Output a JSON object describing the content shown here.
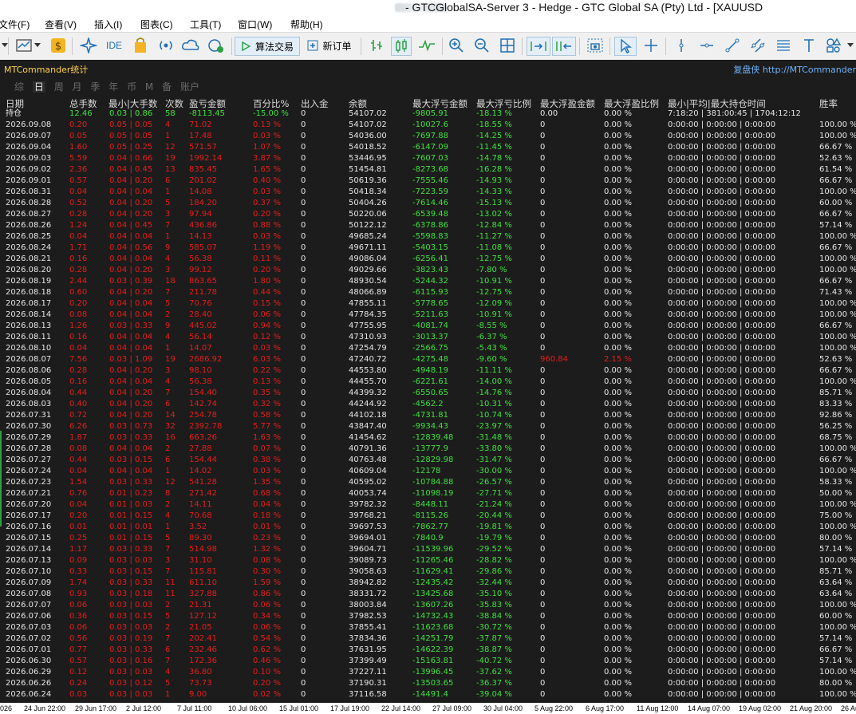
{
  "window": {
    "title": "- GTCGlobalSA-Server 3 - Hedge - GTC Global SA (Pty) Ltd - [XAUUSD"
  },
  "menu": [
    "文件(F)",
    "查看(V)",
    "插入(I)",
    "图表(C)",
    "工具(T)",
    "窗口(W)",
    "帮助(H)"
  ],
  "toolbar": {
    "ide_label": "IDE",
    "algo_label": "算法交易",
    "new_order_label": "新订单"
  },
  "panel": {
    "title": "MTCommander统计",
    "link": "复盘侠 http://MTCommander",
    "tabs": [
      "综",
      "日",
      "周",
      "月",
      "季",
      "年",
      "币",
      "M",
      "备",
      "账户"
    ],
    "active_tab": "日"
  },
  "columns": [
    "日期",
    "总手数",
    "最小|大手数",
    "次数",
    "盈亏金额",
    "百分比%",
    "出入金",
    "余额",
    "最大浮亏金额",
    "最大浮亏比例",
    "最大浮盈金额",
    "最大浮盈比例",
    "最小|平均|最大持仓时间",
    "胜率"
  ],
  "summary": {
    "label": "持仓",
    "lots": "12.46",
    "minmax": "0.03 | 0.86",
    "count": "58",
    "pnl": "-8113.45",
    "pct": "-15.00 %",
    "dep": "0",
    "bal": "54107.02",
    "mfl": "-9805.91",
    "mflp": "-18.13 %",
    "mfp": "0.00",
    "mfpp": "0.00 %",
    "hold": "7:18:20 | 381:00:45 | 1704:12:12",
    "win": ""
  },
  "rows": [
    [
      "2026.09.08",
      "0.20",
      "0.05 | 0.05",
      "4",
      "71.02",
      "0.13 %",
      "0",
      "54107.02",
      "-10027.6",
      "-18.55 %",
      "0",
      "0.00 %",
      "0:00:00 | 0:00:00 | 0:00:00",
      "100.00 %"
    ],
    [
      "2026.09.07",
      "0.05",
      "0.05 | 0.05",
      "1",
      "17.48",
      "0.03 %",
      "0",
      "54036.00",
      "-7697.88",
      "-14.25 %",
      "0",
      "0.00 %",
      "0:00:00 | 0:00:00 | 0:00:00",
      "100.00 %"
    ],
    [
      "2026.09.04",
      "1.60",
      "0.05 | 0.25",
      "12",
      "571.57",
      "1.07 %",
      "0",
      "54018.52",
      "-6147.09",
      "-11.45 %",
      "0",
      "0.00 %",
      "0:00:00 | 0:00:00 | 0:00:00",
      "66.67 %"
    ],
    [
      "2026.09.03",
      "5.59",
      "0.04 | 0.66",
      "19",
      "1992.14",
      "3.87 %",
      "0",
      "53446.95",
      "-7607.03",
      "-14.78 %",
      "0",
      "0.00 %",
      "0:00:00 | 0:00:00 | 0:00:00",
      "52.63 %"
    ],
    [
      "2026.09.02",
      "2.36",
      "0.04 | 0.45",
      "13",
      "835.45",
      "1.65 %",
      "0",
      "51454.81",
      "-8273.68",
      "-16.28 %",
      "0",
      "0.00 %",
      "0:00:00 | 0:00:00 | 0:00:00",
      "61.54 %"
    ],
    [
      "2026.09.01",
      "0.57",
      "0.04 | 0.20",
      "6",
      "201.02",
      "0.40 %",
      "0",
      "50619.36",
      "-7555.46",
      "-14.93 %",
      "0",
      "0.00 %",
      "0:00:00 | 0:00:00 | 0:00:00",
      "66.67 %"
    ],
    [
      "2026.08.31",
      "0.04",
      "0.04 | 0.04",
      "1",
      "14.08",
      "0.03 %",
      "0",
      "50418.34",
      "-7223.59",
      "-14.33 %",
      "0",
      "0.00 %",
      "0:00:00 | 0:00:00 | 0:00:00",
      "100.00 %"
    ],
    [
      "2026.08.28",
      "0.52",
      "0.04 | 0.20",
      "5",
      "184.20",
      "0.37 %",
      "0",
      "50404.26",
      "-7614.46",
      "-15.13 %",
      "0",
      "0.00 %",
      "0:00:00 | 0:00:00 | 0:00:00",
      "60.00 %"
    ],
    [
      "2026.08.27",
      "0.28",
      "0.04 | 0.20",
      "3",
      "97.94",
      "0.20 %",
      "0",
      "50220.06",
      "-6539.48",
      "-13.02 %",
      "0",
      "0.00 %",
      "0:00:00 | 0:00:00 | 0:00:00",
      "66.67 %"
    ],
    [
      "2026.08.26",
      "1.24",
      "0.04 | 0.45",
      "7",
      "436.86",
      "0.88 %",
      "0",
      "50122.12",
      "-6378.86",
      "-12.84 %",
      "0",
      "0.00 %",
      "0:00:00 | 0:00:00 | 0:00:00",
      "57.14 %"
    ],
    [
      "2026.08.25",
      "0.04",
      "0.04 | 0.04",
      "1",
      "14.13",
      "0.03 %",
      "0",
      "49685.24",
      "-5598.83",
      "-11.27 %",
      "0",
      "0.00 %",
      "0:00:00 | 0:00:00 | 0:00:00",
      "100.00 %"
    ],
    [
      "2026.08.24",
      "1.71",
      "0.04 | 0.56",
      "9",
      "585.07",
      "1.19 %",
      "0",
      "49671.11",
      "-5403.15",
      "-11.08 %",
      "0",
      "0.00 %",
      "0:00:00 | 0:00:00 | 0:00:00",
      "66.67 %"
    ],
    [
      "2026.08.21",
      "0.16",
      "0.04 | 0.04",
      "4",
      "56.38",
      "0.11 %",
      "0",
      "49086.04",
      "-6256.41",
      "-12.75 %",
      "0",
      "0.00 %",
      "0:00:00 | 0:00:00 | 0:00:00",
      "100.00 %"
    ],
    [
      "2026.08.20",
      "0.28",
      "0.04 | 0.20",
      "3",
      "99.12",
      "0.20 %",
      "0",
      "49029.66",
      "-3823.43",
      "-7.80 %",
      "0",
      "0.00 %",
      "0:00:00 | 0:00:00 | 0:00:00",
      "100.00 %"
    ],
    [
      "2026.08.19",
      "2.44",
      "0.03 | 0.39",
      "18",
      "863.65",
      "1.80 %",
      "0",
      "48930.54",
      "-5244.32",
      "-10.91 %",
      "0",
      "0.00 %",
      "0:00:00 | 0:00:00 | 0:00:00",
      "66.67 %"
    ],
    [
      "2026.08.18",
      "0.60",
      "0.04 | 0.20",
      "7",
      "211.78",
      "0.44 %",
      "0",
      "48066.89",
      "-6115.93",
      "-12.75 %",
      "0",
      "0.00 %",
      "0:00:00 | 0:00:00 | 0:00:00",
      "71.43 %"
    ],
    [
      "2026.08.17",
      "0.20",
      "0.04 | 0.04",
      "5",
      "70.76",
      "0.15 %",
      "0",
      "47855.11",
      "-5778.65",
      "-12.09 %",
      "0",
      "0.00 %",
      "0:00:00 | 0:00:00 | 0:00:00",
      "100.00 %"
    ],
    [
      "2026.08.14",
      "0.08",
      "0.04 | 0.04",
      "2",
      "28.40",
      "0.06 %",
      "0",
      "47784.35",
      "-5211.63",
      "-10.91 %",
      "0",
      "0.00 %",
      "0:00:00 | 0:00:00 | 0:00:00",
      "100.00 %"
    ],
    [
      "2026.08.13",
      "1.26",
      "0.03 | 0.33",
      "9",
      "445.02",
      "0.94 %",
      "0",
      "47755.95",
      "-4081.74",
      "-8.55 %",
      "0",
      "0.00 %",
      "0:00:00 | 0:00:00 | 0:00:00",
      "66.67 %"
    ],
    [
      "2026.08.11",
      "0.16",
      "0.04 | 0.04",
      "4",
      "56.14",
      "0.12 %",
      "0",
      "47310.93",
      "-3013.37",
      "-6.37 %",
      "0",
      "0.00 %",
      "0:00:00 | 0:00:00 | 0:00:00",
      "100.00 %"
    ],
    [
      "2026.08.10",
      "0.04",
      "0.04 | 0.04",
      "1",
      "14.07",
      "0.03 %",
      "0",
      "47254.79",
      "-2566.75",
      "-5.43 %",
      "0",
      "0.00 %",
      "0:00:00 | 0:00:00 | 0:00:00",
      "100.00 %"
    ],
    [
      "2026.08.07",
      "7.56",
      "0.03 | 1.09",
      "19",
      "2686.92",
      "6.03 %",
      "0",
      "47240.72",
      "-4275.48",
      "-9.60 %",
      "960.84",
      "2.15 %",
      "0:00:00 | 0:00:00 | 0:00:00",
      "52.63 %"
    ],
    [
      "2026.08.06",
      "0.28",
      "0.04 | 0.20",
      "3",
      "98.10",
      "0.22 %",
      "0",
      "44553.80",
      "-4948.19",
      "-11.11 %",
      "0",
      "0.00 %",
      "0:00:00 | 0:00:00 | 0:00:00",
      "66.67 %"
    ],
    [
      "2026.08.05",
      "0.16",
      "0.04 | 0.04",
      "4",
      "56.38",
      "0.13 %",
      "0",
      "44455.70",
      "-6221.61",
      "-14.00 %",
      "0",
      "0.00 %",
      "0:00:00 | 0:00:00 | 0:00:00",
      "100.00 %"
    ],
    [
      "2026.08.04",
      "0.44",
      "0.04 | 0.20",
      "7",
      "154.40",
      "0.35 %",
      "0",
      "44399.32",
      "-6550.65",
      "-14.76 %",
      "0",
      "0.00 %",
      "0:00:00 | 0:00:00 | 0:00:00",
      "85.71 %"
    ],
    [
      "2026.08.03",
      "0.40",
      "0.04 | 0.20",
      "6",
      "142.74",
      "0.32 %",
      "0",
      "44244.92",
      "-4562.2",
      "-10.31 %",
      "0",
      "0.00 %",
      "0:00:00 | 0:00:00 | 0:00:00",
      "83.33 %"
    ],
    [
      "2026.07.31",
      "0.72",
      "0.04 | 0.20",
      "14",
      "254.78",
      "0.58 %",
      "0",
      "44102.18",
      "-4731.81",
      "-10.74 %",
      "0",
      "0.00 %",
      "0:00:00 | 0:00:00 | 0:00:00",
      "92.86 %"
    ],
    [
      "2026.07.30",
      "6.26",
      "0.03 | 0.73",
      "32",
      "2392.78",
      "5.77 %",
      "0",
      "43847.40",
      "-9934.43",
      "-23.97 %",
      "0",
      "0.00 %",
      "0:00:00 | 0:00:00 | 0:00:00",
      "56.25 %"
    ],
    [
      "2026.07.29",
      "1.87",
      "0.03 | 0.33",
      "16",
      "663.26",
      "1.63 %",
      "0",
      "41454.62",
      "-12839.48",
      "-31.48 %",
      "0",
      "0.00 %",
      "0:00:00 | 0:00:00 | 0:00:00",
      "68.75 %"
    ],
    [
      "2026.07.28",
      "0.08",
      "0.04 | 0.04",
      "2",
      "27.88",
      "0.07 %",
      "0",
      "40791.36",
      "-13777.9",
      "-33.80 %",
      "0",
      "0.00 %",
      "0:00:00 | 0:00:00 | 0:00:00",
      "100.00 %"
    ],
    [
      "2026.07.27",
      "0.44",
      "0.03 | 0.15",
      "6",
      "154.44",
      "0.38 %",
      "0",
      "40763.48",
      "-12829.98",
      "-31.47 %",
      "0",
      "0.00 %",
      "0:00:00 | 0:00:00 | 0:00:00",
      "66.67 %"
    ],
    [
      "2026.07.24",
      "0.04",
      "0.04 | 0.04",
      "1",
      "14.02",
      "0.03 %",
      "0",
      "40609.04",
      "-12178",
      "-30.00 %",
      "0",
      "0.00 %",
      "0:00:00 | 0:00:00 | 0:00:00",
      "100.00 %"
    ],
    [
      "2026.07.23",
      "1.54",
      "0.03 | 0.33",
      "12",
      "541.28",
      "1.35 %",
      "0",
      "40595.02",
      "-10784.88",
      "-26.57 %",
      "0",
      "0.00 %",
      "0:00:00 | 0:00:00 | 0:00:00",
      "58.33 %"
    ],
    [
      "2026.07.21",
      "0.76",
      "0.01 | 0.23",
      "8",
      "271.42",
      "0.68 %",
      "0",
      "40053.74",
      "-11098.19",
      "-27.71 %",
      "0",
      "0.00 %",
      "0:00:00 | 0:00:00 | 0:00:00",
      "50.00 %"
    ],
    [
      "2026.07.20",
      "0.04",
      "0.01 | 0.03",
      "2",
      "14.11",
      "0.04 %",
      "0",
      "39782.32",
      "-8448.11",
      "-21.24 %",
      "0",
      "0.00 %",
      "0:00:00 | 0:00:00 | 0:00:00",
      "100.00 %"
    ],
    [
      "2026.07.17",
      "0.20",
      "0.01 | 0.15",
      "4",
      "70.68",
      "0.18 %",
      "0",
      "39768.21",
      "-8115.26",
      "-20.44 %",
      "0",
      "0.00 %",
      "0:00:00 | 0:00:00 | 0:00:00",
      "75.00 %"
    ],
    [
      "2026.07.16",
      "0.01",
      "0.01 | 0.01",
      "1",
      "3.52",
      "0.01 %",
      "0",
      "39697.53",
      "-7862.77",
      "-19.81 %",
      "0",
      "0.00 %",
      "0:00:00 | 0:00:00 | 0:00:00",
      "100.00 %"
    ],
    [
      "2026.07.15",
      "0.25",
      "0.01 | 0.15",
      "5",
      "89.30",
      "0.23 %",
      "0",
      "39694.01",
      "-7840.9",
      "-19.79 %",
      "0",
      "0.00 %",
      "0:00:00 | 0:00:00 | 0:00:00",
      "80.00 %"
    ],
    [
      "2026.07.14",
      "1.17",
      "0.03 | 0.33",
      "7",
      "514.98",
      "1.32 %",
      "0",
      "39604.71",
      "-11539.96",
      "-29.52 %",
      "0",
      "0.00 %",
      "0:00:00 | 0:00:00 | 0:00:00",
      "57.14 %"
    ],
    [
      "2026.07.13",
      "0.09",
      "0.03 | 0.03",
      "3",
      "31.10",
      "0.08 %",
      "0",
      "39089.73",
      "-11265.46",
      "-28.82 %",
      "0",
      "0.00 %",
      "0:00:00 | 0:00:00 | 0:00:00",
      "100.00 %"
    ],
    [
      "2026.07.10",
      "0.33",
      "0.03 | 0.15",
      "7",
      "115.81",
      "0.30 %",
      "0",
      "39058.63",
      "-11629.41",
      "-29.86 %",
      "0",
      "0.00 %",
      "0:00:00 | 0:00:00 | 0:00:00",
      "85.71 %"
    ],
    [
      "2026.07.09",
      "1.74",
      "0.03 | 0.33",
      "11",
      "611.10",
      "1.59 %",
      "0",
      "38942.82",
      "-12435.42",
      "-32.44 %",
      "0",
      "0.00 %",
      "0:00:00 | 0:00:00 | 0:00:00",
      "63.64 %"
    ],
    [
      "2026.07.08",
      "0.93",
      "0.03 | 0.18",
      "11",
      "327.88",
      "0.86 %",
      "0",
      "38331.72",
      "-13425.68",
      "-35.10 %",
      "0",
      "0.00 %",
      "0:00:00 | 0:00:00 | 0:00:00",
      "63.64 %"
    ],
    [
      "2026.07.07",
      "0.06",
      "0.03 | 0.03",
      "2",
      "21.31",
      "0.06 %",
      "0",
      "38003.84",
      "-13607.26",
      "-35.83 %",
      "0",
      "0.00 %",
      "0:00:00 | 0:00:00 | 0:00:00",
      "100.00 %"
    ],
    [
      "2026.07.06",
      "0.36",
      "0.03 | 0.15",
      "5",
      "127.12",
      "0.34 %",
      "0",
      "37982.53",
      "-14732.43",
      "-38.84 %",
      "0",
      "0.00 %",
      "0:00:00 | 0:00:00 | 0:00:00",
      "60.00 %"
    ],
    [
      "2026.07.03",
      "0.06",
      "0.03 | 0.03",
      "2",
      "21.05",
      "0.06 %",
      "0",
      "37855.41",
      "-11623.68",
      "-30.72 %",
      "0",
      "0.00 %",
      "0:00:00 | 0:00:00 | 0:00:00",
      "100.00 %"
    ],
    [
      "2026.07.02",
      "0.56",
      "0.03 | 0.19",
      "7",
      "202.41",
      "0.54 %",
      "0",
      "37834.36",
      "-14251.79",
      "-37.87 %",
      "0",
      "0.00 %",
      "0:00:00 | 0:00:00 | 0:00:00",
      "57.14 %"
    ],
    [
      "2026.07.01",
      "0.77",
      "0.03 | 0.33",
      "6",
      "232.46",
      "0.62 %",
      "0",
      "37631.95",
      "-14622.39",
      "-38.87 %",
      "0",
      "0.00 %",
      "0:00:00 | 0:00:00 | 0:00:00",
      "66.67 %"
    ],
    [
      "2026.06.30",
      "0.57",
      "0.03 | 0.16",
      "7",
      "172.36",
      "0.46 %",
      "0",
      "37399.49",
      "-15163.81",
      "-40.72 %",
      "0",
      "0.00 %",
      "0:00:00 | 0:00:00 | 0:00:00",
      "57.14 %"
    ],
    [
      "2026.06.29",
      "0.12",
      "0.03 | 0.03",
      "4",
      "36.80",
      "0.10 %",
      "0",
      "37227.11",
      "-13996.45",
      "-37.62 %",
      "0",
      "0.00 %",
      "0:00:00 | 0:00:00 | 0:00:00",
      "100.00 %"
    ],
    [
      "2026.06.26",
      "0.24",
      "0.03 | 0.12",
      "5",
      "73.73",
      "0.20 %",
      "0",
      "37190.31",
      "-13503.65",
      "-36.37 %",
      "0",
      "0.00 %",
      "0:00:00 | 0:00:00 | 0:00:00",
      "80.00 %"
    ],
    [
      "2026.06.24",
      "0.03",
      "0.03 | 0.03",
      "1",
      "9.00",
      "0.02 %",
      "0",
      "37116.58",
      "-14491.4",
      "-39.04 %",
      "0",
      "0.00 %",
      "0:00:00 | 0:00:00 | 0:00:00",
      "100.00 %"
    ]
  ],
  "axis_labels": [
    "026",
    "24 Jun 22:00",
    "29 Jun 17:00",
    "2 Jul 12:00",
    "7 Jul 11:00",
    "10 Jul 06:00",
    "15 Jul 01:00",
    "17 Jul 19:00",
    "22 Jul 14:00",
    "27 Jul 09:00",
    "30 Jul 04:00",
    "5 Aug 22:00",
    "6 Aug 17:00",
    "11 Aug 12:00",
    "14 Aug 07:00",
    "19 Aug 02:00",
    "21 Aug 20:00",
    "26 Au"
  ],
  "colors": {
    "panel_bg": "#1c1c1c",
    "text": "#e6e6e6",
    "negative_or_profit": "#e81c1c",
    "summary_green": "#3fe03f",
    "title": "#ffd24a",
    "link": "#6fb3ff"
  }
}
